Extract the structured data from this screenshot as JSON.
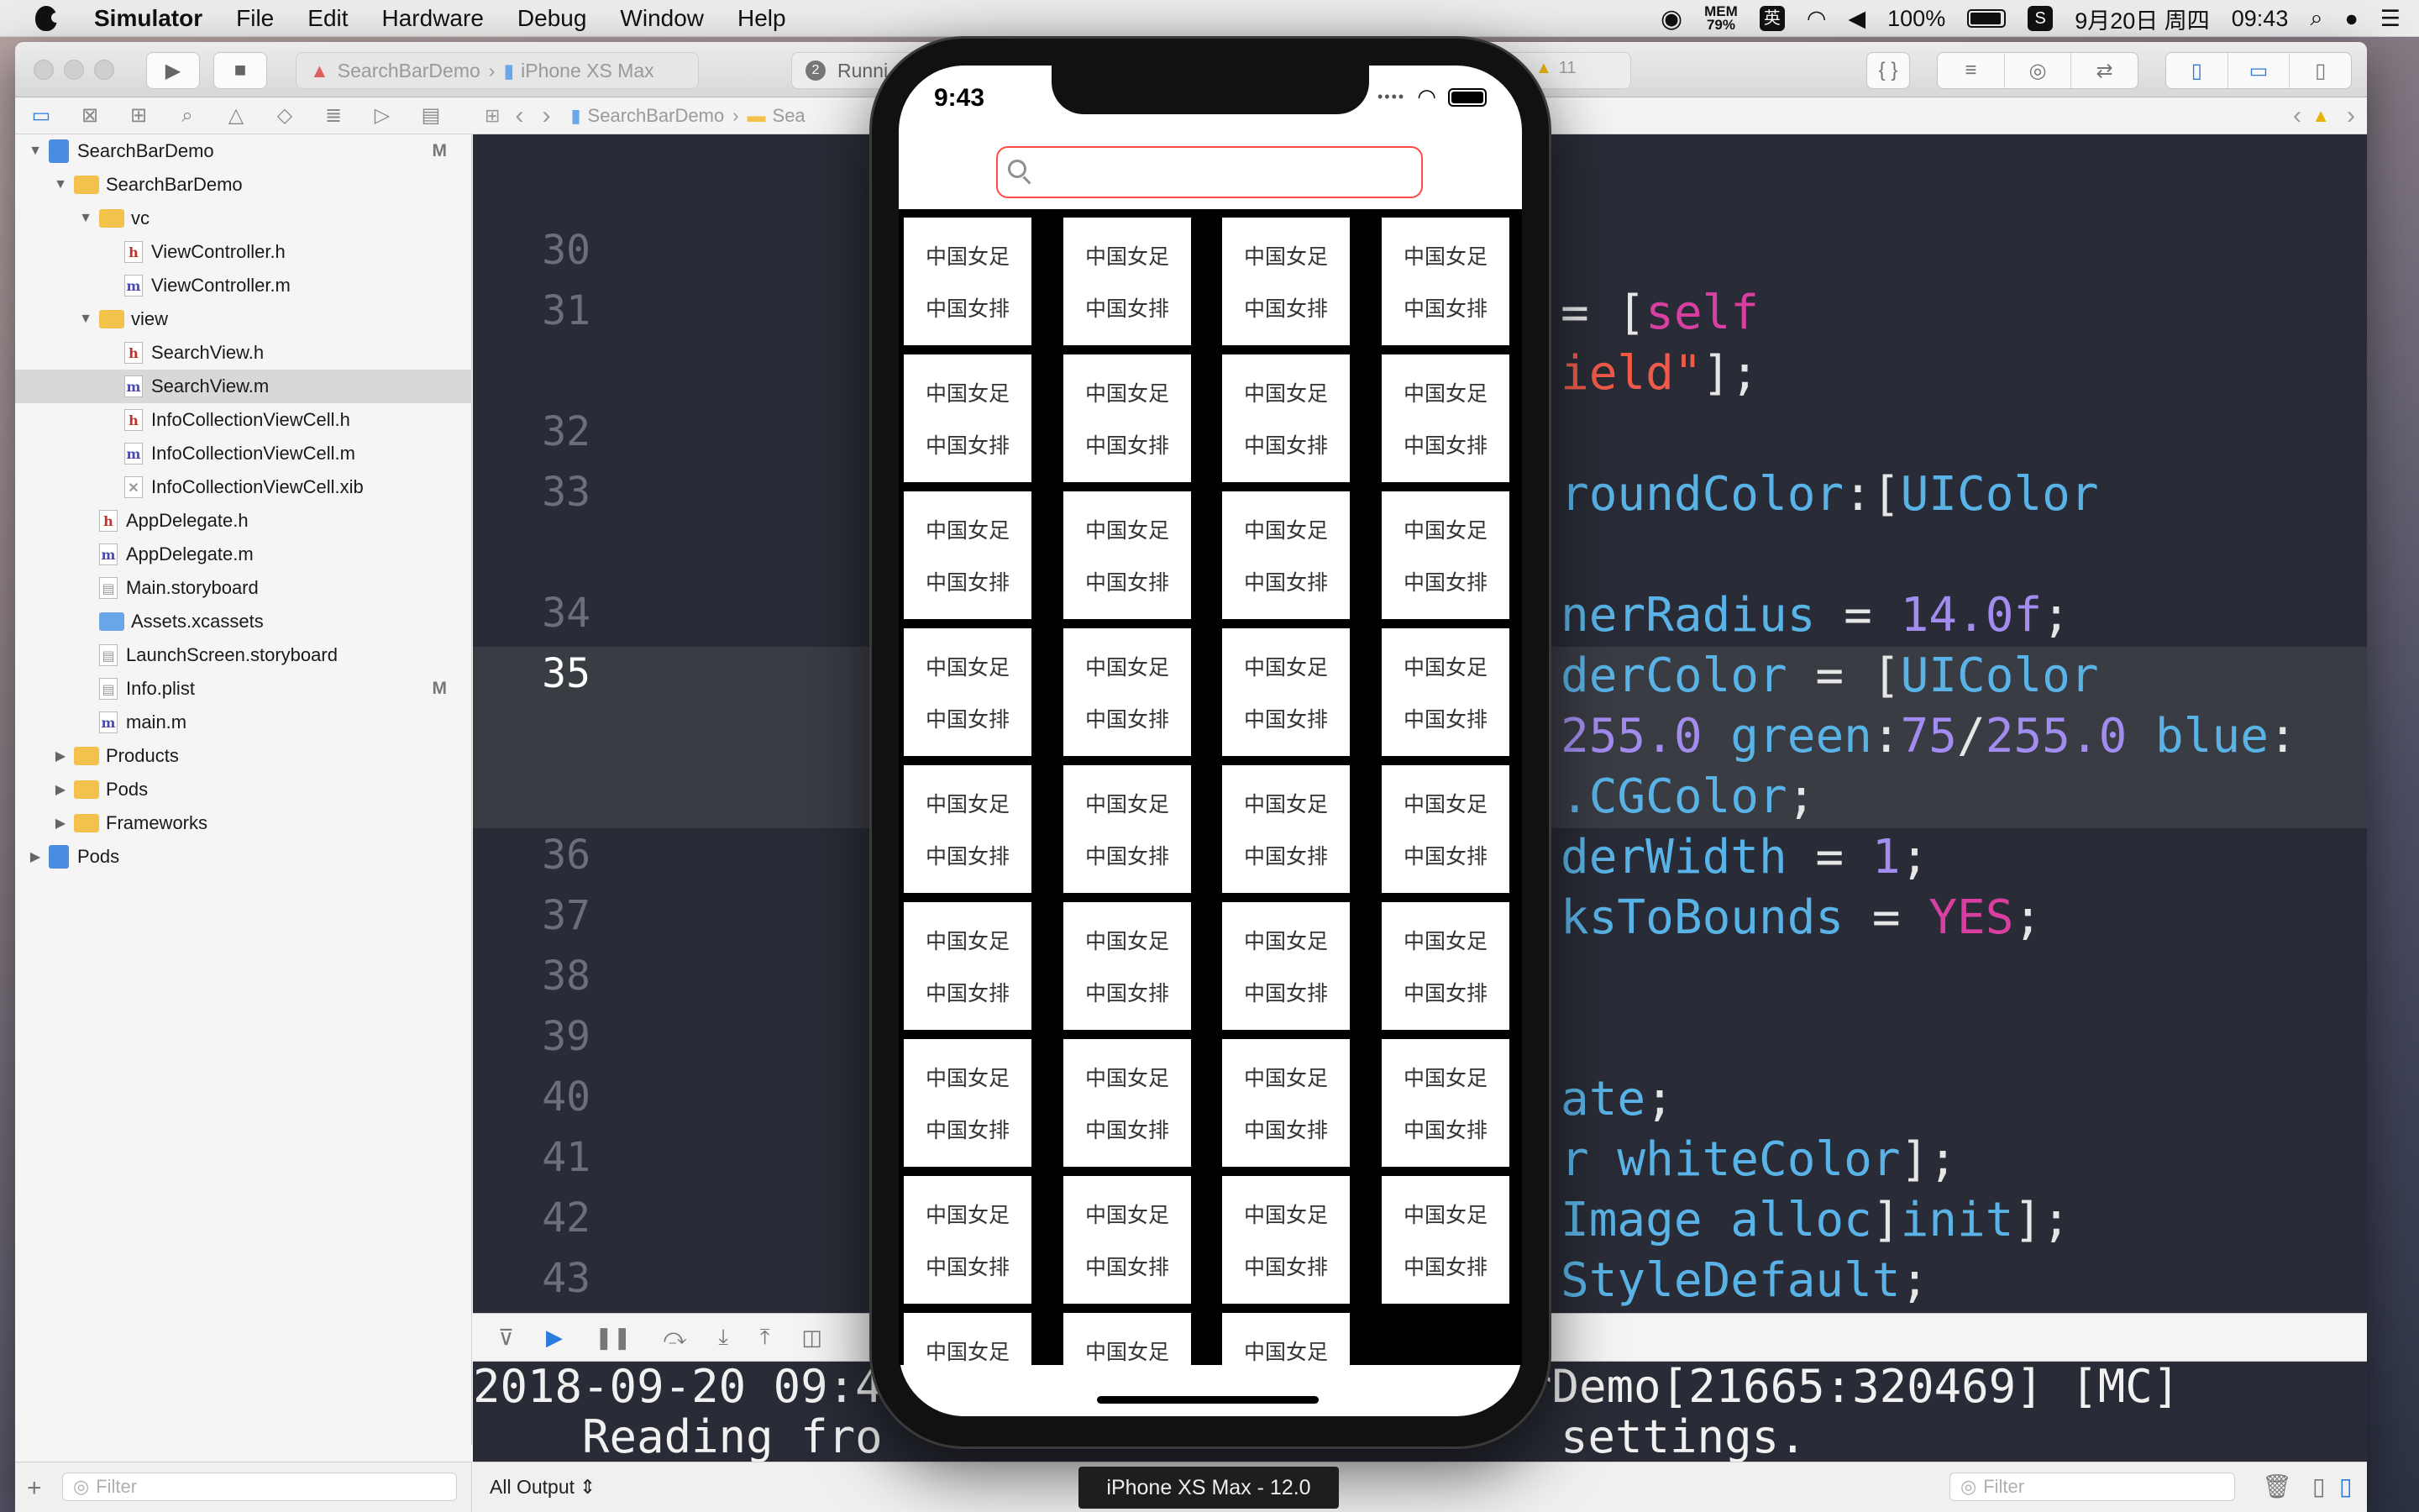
{
  "menubar": {
    "app": "Simulator",
    "items": [
      "File",
      "Edit",
      "Hardware",
      "Debug",
      "Window",
      "Help"
    ],
    "mem_label": "MEM",
    "mem_value": "79%",
    "input_method": "英",
    "battery": "100%",
    "date": "9月20日 周四",
    "time": "09:43"
  },
  "toolbar": {
    "scheme": "SearchBarDemo",
    "destination": "iPhone XS Max",
    "activity_count": "2",
    "activity_text": "Runni",
    "warning_count": "11"
  },
  "navigator": {
    "items": [
      {
        "label": "SearchBarDemo",
        "kind": "project",
        "badge": "M"
      },
      {
        "label": "SearchBarDemo",
        "kind": "folder"
      },
      {
        "label": "vc",
        "kind": "folder"
      },
      {
        "label": "ViewController.h",
        "kind": "h"
      },
      {
        "label": "ViewController.m",
        "kind": "m"
      },
      {
        "label": "view",
        "kind": "folder"
      },
      {
        "label": "SearchView.h",
        "kind": "h"
      },
      {
        "label": "SearchView.m",
        "kind": "m",
        "selected": true
      },
      {
        "label": "InfoCollectionViewCell.h",
        "kind": "h"
      },
      {
        "label": "InfoCollectionViewCell.m",
        "kind": "m"
      },
      {
        "label": "InfoCollectionViewCell.xib",
        "kind": "xib"
      },
      {
        "label": "AppDelegate.h",
        "kind": "h"
      },
      {
        "label": "AppDelegate.m",
        "kind": "m"
      },
      {
        "label": "Main.storyboard",
        "kind": "storyboard"
      },
      {
        "label": "Assets.xcassets",
        "kind": "assets"
      },
      {
        "label": "LaunchScreen.storyboard",
        "kind": "storyboard"
      },
      {
        "label": "Info.plist",
        "kind": "plist",
        "badge": "M"
      },
      {
        "label": "main.m",
        "kind": "m"
      },
      {
        "label": "Products",
        "kind": "folder"
      },
      {
        "label": "Pods",
        "kind": "folder"
      },
      {
        "label": "Frameworks",
        "kind": "folder"
      },
      {
        "label": "Pods",
        "kind": "project"
      }
    ],
    "filter_placeholder": "Filter"
  },
  "jumpbar": {
    "crumb1": "SearchBarDemo",
    "crumb2": "Sea"
  },
  "editor": {
    "line_numbers": [
      "30",
      "31",
      "32",
      "33",
      "34",
      "35",
      "36",
      "37",
      "38",
      "39",
      "40",
      "41",
      "42",
      "43"
    ],
    "current_line": "35"
  },
  "console": {
    "line1_a": "2018-09-20 09:4",
    "line1_b": "rDemo[21665:320469] [MC]",
    "line2_a": "    Reading fro",
    "line2_b": "settings."
  },
  "bottombar": {
    "output_select": "All Output",
    "filter_placeholder": "Filter"
  },
  "simulator": {
    "time": "9:43",
    "cell_line1": "中国女足",
    "cell_line2": "中国女排",
    "search_border_color": "#ff4b44",
    "device_label": "iPhone XS Max - 12.0"
  }
}
